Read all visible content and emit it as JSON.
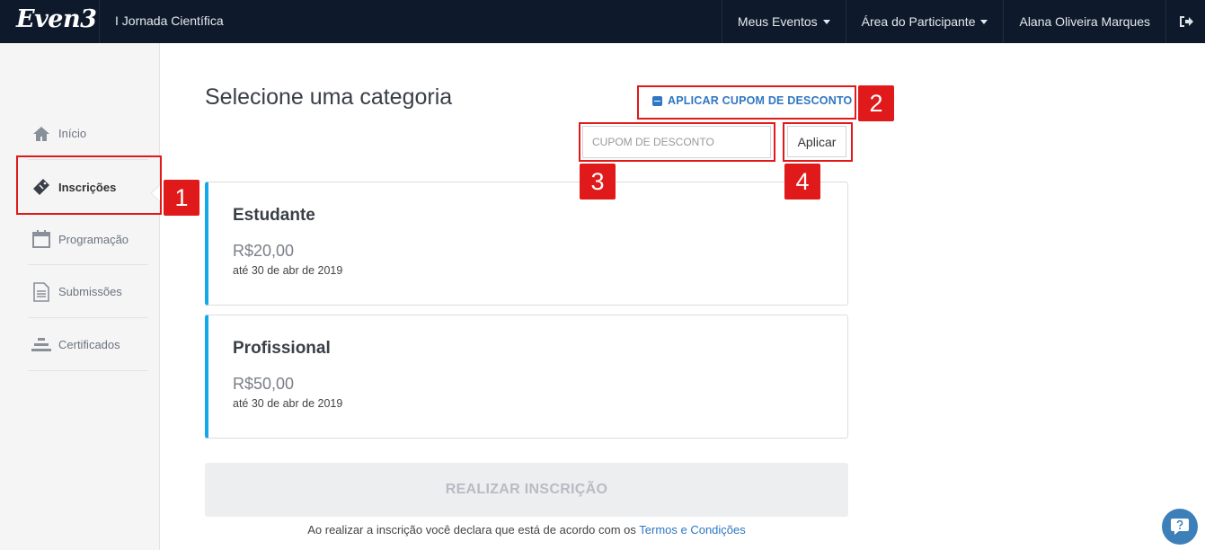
{
  "navbar": {
    "logo": "Even3",
    "event_title": "I Jornada Científica",
    "menu": [
      {
        "label": "Meus Eventos"
      },
      {
        "label": "Área do Participante"
      },
      {
        "label": "Alana Oliveira Marques"
      }
    ],
    "logout_icon": "sign-out-icon"
  },
  "sidebar": {
    "items": [
      {
        "label": "Início",
        "icon": "home-icon"
      },
      {
        "label": "Inscrições",
        "icon": "ticket-icon",
        "active": true
      },
      {
        "label": "Programação",
        "icon": "calendar-icon"
      },
      {
        "label": "Submissões",
        "icon": "document-icon"
      },
      {
        "label": "Certificados",
        "icon": "certificate-icon"
      }
    ]
  },
  "main": {
    "title": "Selecione uma categoria",
    "coupon_toggle_label": "APLICAR CUPOM DE DESCONTO",
    "coupon_placeholder": "CUPOM DE DESCONTO",
    "coupon_value": "",
    "apply_label": "Aplicar",
    "categories": [
      {
        "name": "Estudante",
        "price": "R$20,00",
        "until": "até 30 de abr de 2019"
      },
      {
        "name": "Profissional",
        "price": "R$50,00",
        "until": "até 30 de abr de 2019"
      }
    ],
    "submit_label": "REALIZAR INSCRIÇÃO",
    "terms_text": "Ao realizar a inscrição você declara que está de acordo com os",
    "terms_link": "Termos e Condições"
  },
  "annotations": [
    "1",
    "2",
    "3",
    "4"
  ],
  "colors": {
    "navbar_bg": "#0e1a2b",
    "accent": "#13a8e8",
    "link": "#2e77c2",
    "annotation": "#e01a1a"
  }
}
